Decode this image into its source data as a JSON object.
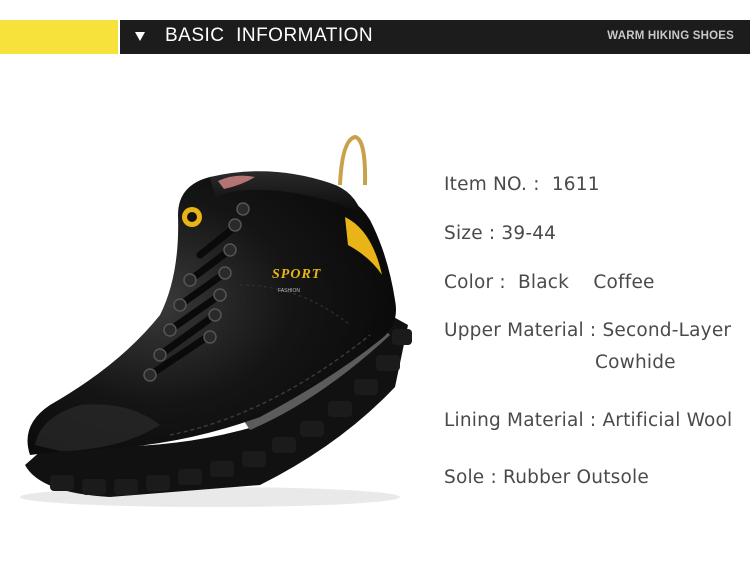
{
  "header": {
    "accent_color": "#f7e13b",
    "band_color": "#1c1c1c",
    "title": "BASIC  INFORMATION",
    "tag": "WARM HIKING SHOES"
  },
  "product": {
    "image_icon": "hiking-boot",
    "shoe_brand_text": "SPORT",
    "shoe_sub_text": "FASHION",
    "colors": [
      "#0e0e0e",
      "#e8b417"
    ]
  },
  "specs": {
    "item_no": {
      "label": "Item NO. :",
      "value": "1611"
    },
    "size": {
      "label": "Size :",
      "value": "39-44"
    },
    "color": {
      "label": "Color :",
      "value1": "Black",
      "value2": "Coffee"
    },
    "upper_material": {
      "label": "Upper Material :",
      "value_line1": "Second-Layer",
      "value_line2": "Cowhide"
    },
    "lining_material": {
      "label": "Lining Material :",
      "value": "Artificial Wool"
    },
    "sole": {
      "label": "Sole :",
      "value": "Rubber Outsole"
    }
  }
}
